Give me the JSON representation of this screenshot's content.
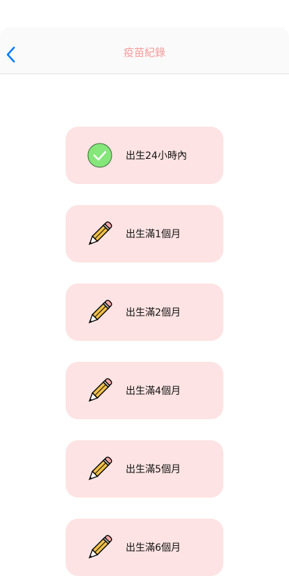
{
  "header": {
    "title": "疫苗紀錄",
    "back_icon": "chevron-left-icon",
    "accent": "#0a7aff",
    "title_color": "#f59a9a"
  },
  "records": [
    {
      "label": "出生24小時內",
      "icon": "check-circle-icon",
      "done": true
    },
    {
      "label": "出生滿1個月",
      "icon": "pencil-icon",
      "done": false
    },
    {
      "label": "出生滿2個月",
      "icon": "pencil-icon",
      "done": false
    },
    {
      "label": "出生滿4個月",
      "icon": "pencil-icon",
      "done": false
    },
    {
      "label": "出生滿5個月",
      "icon": "pencil-icon",
      "done": false
    },
    {
      "label": "出生滿6個月",
      "icon": "pencil-icon",
      "done": false
    }
  ],
  "colors": {
    "card": "#fde3e3",
    "check": "#85e67a"
  }
}
